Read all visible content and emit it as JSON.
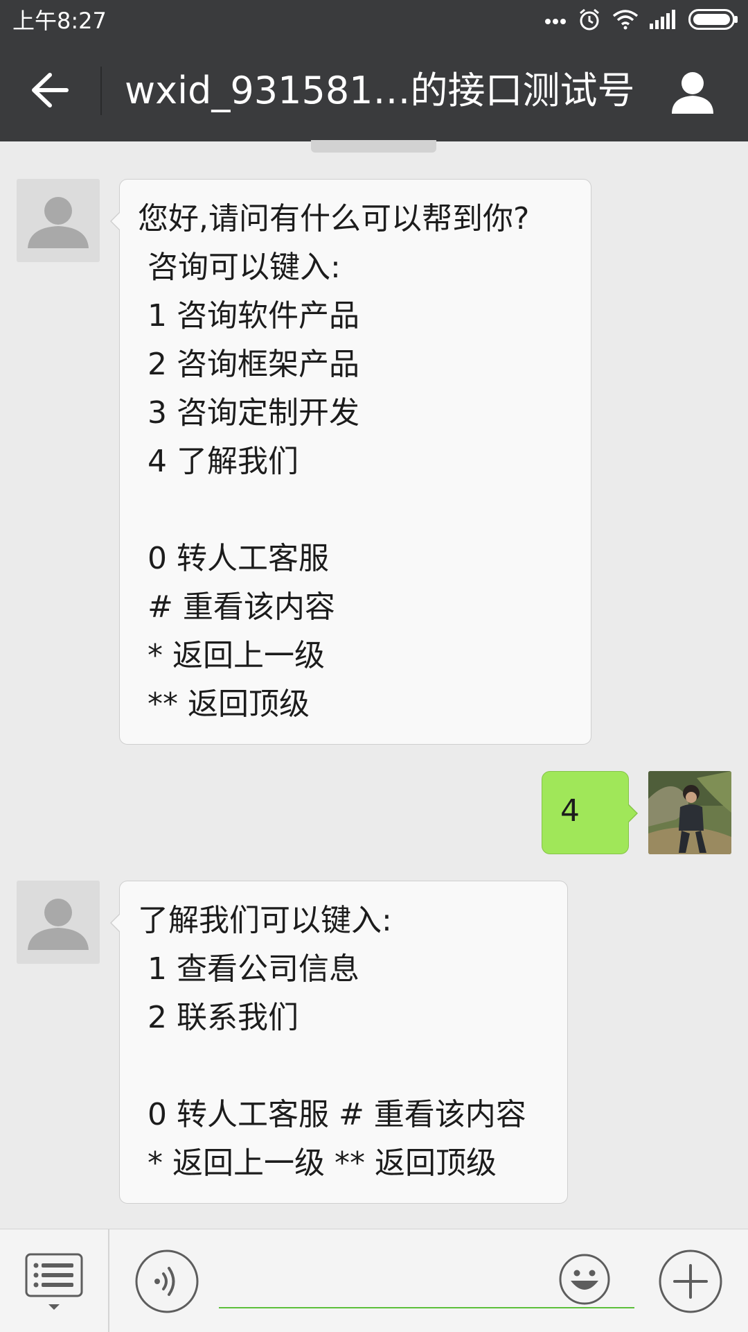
{
  "status_bar": {
    "time": "上午8:27",
    "icons": [
      "more-dots-icon",
      "alarm-clock-icon",
      "wifi-icon",
      "signal-bars-icon",
      "battery-icon"
    ]
  },
  "header": {
    "title": "wxid_931581…的接口测试号",
    "back_icon": "back-arrow-icon",
    "profile_icon": "person-icon",
    "background": "#3a3b3d"
  },
  "messages": [
    {
      "direction": "incoming",
      "lines": [
        "您好,请问有什么可以帮到你?",
        " 咨询可以键入:",
        " 1 咨询软件产品",
        " 2 咨询框架产品",
        " 3 咨询定制开发",
        " 4 了解我们",
        "",
        " 0 转人工客服",
        " # 重看该内容",
        " * 返回上一级",
        " ** 返回顶级"
      ]
    },
    {
      "direction": "outgoing",
      "text": "4"
    },
    {
      "direction": "incoming",
      "lines": [
        "了解我们可以键入:",
        " 1 查看公司信息",
        " 2 联系我们",
        "",
        " 0 转人工客服 # 重看该内容",
        " * 返回上一级 ** 返回顶级"
      ]
    }
  ],
  "input_bar": {
    "menu_icon": "list-menu-icon",
    "voice_icon": "voice-icon",
    "emoji_icon": "smiley-icon",
    "plus_icon": "plus-icon",
    "input_value": "",
    "accent": "#5cbf3a"
  },
  "colors": {
    "outgoing_bubble": "#a0e759",
    "incoming_bubble": "#f9f9f9",
    "chat_background": "#ebebeb"
  }
}
